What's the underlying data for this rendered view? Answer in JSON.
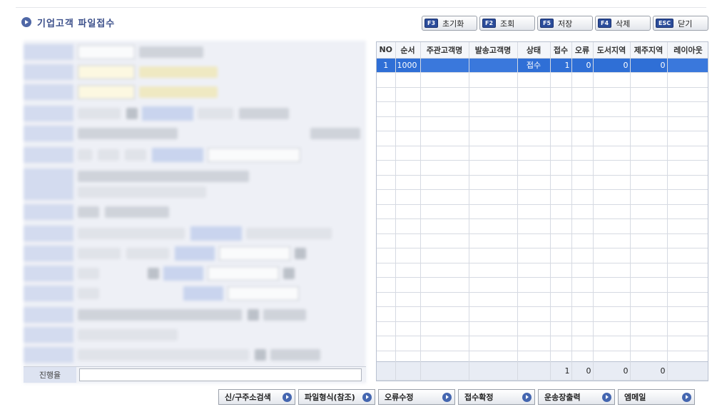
{
  "window": {
    "title": "기업고객 파일접수"
  },
  "toolbar": [
    {
      "key": "F3",
      "label": "초기화"
    },
    {
      "key": "F2",
      "label": "조회"
    },
    {
      "key": "F5",
      "label": "저장"
    },
    {
      "key": "F4",
      "label": "삭제"
    },
    {
      "key": "ESC",
      "label": "닫기"
    }
  ],
  "form": {
    "progress_label": "진행율",
    "progress_value": ""
  },
  "grid": {
    "columns": [
      "NO",
      "순서",
      "주관고객명",
      "발송고객명",
      "상태",
      "접수",
      "오류",
      "도서지역",
      "제주지역",
      "레이아웃"
    ],
    "rows": [
      {
        "no": "1",
        "seq": "1000",
        "host": "",
        "sender": "",
        "status": "접수",
        "received": "1",
        "error": "0",
        "island": "0",
        "jeju": "0",
        "layout": ""
      }
    ],
    "totals": {
      "received": "1",
      "error": "0",
      "island": "0",
      "jeju": "0"
    }
  },
  "bottom_buttons": [
    {
      "label": "신/구주소검색"
    },
    {
      "label": "파일형식(참조)"
    },
    {
      "label": "오류수정"
    },
    {
      "label": "접수확정"
    },
    {
      "label": "운송장출력"
    },
    {
      "label": "엠메일"
    }
  ],
  "colors": {
    "selection": "#2f6fd6",
    "accent": "#2b4c9a"
  }
}
